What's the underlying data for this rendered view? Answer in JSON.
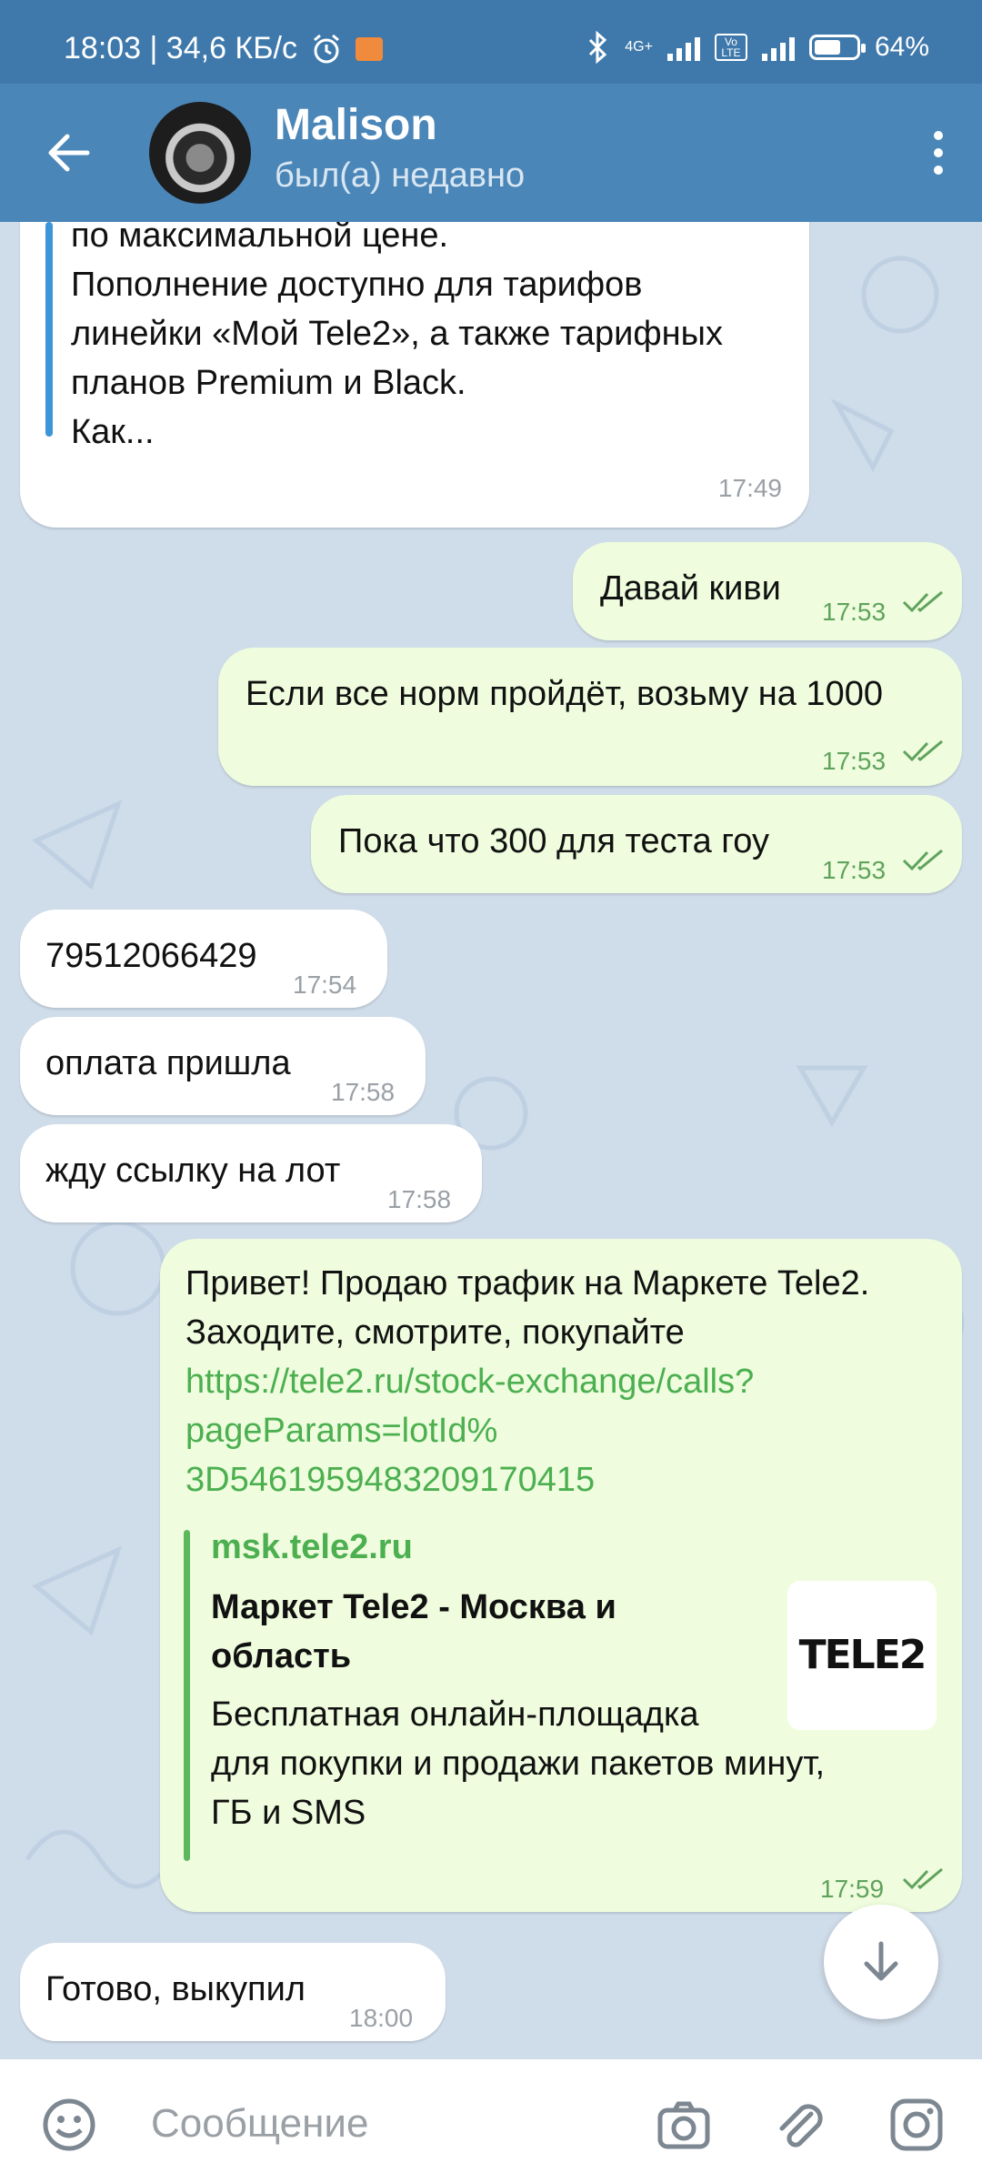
{
  "status_bar": {
    "time_speed": "18:03 | 34,6 КБ/с",
    "network_1": "4G+",
    "network_2": "Vo LTE",
    "battery": "64%",
    "battery_level": 0.64
  },
  "header": {
    "contact_name": "Malison",
    "contact_status": "был(а) недавно"
  },
  "messages": {
    "m1": {
      "lines": [
        "по максимальной цене.",
        "Пополнение доступно для тарифов",
        "линейки «Мой Tele2», а также тарифных",
        "планов Premium и Black.",
        "Как..."
      ],
      "time": "17:49"
    },
    "m2": {
      "text": "Давай киви",
      "time": "17:53"
    },
    "m3": {
      "text": "Если все норм пройдёт, возьму на 1000",
      "time": "17:53"
    },
    "m4": {
      "text": "Пока что 300 для теста гоу",
      "time": "17:53"
    },
    "m5": {
      "text": "79512066429",
      "time": "17:54"
    },
    "m6": {
      "text": "оплата пришла",
      "time": "17:58"
    },
    "m7": {
      "text": "жду ссылку на лот",
      "time": "17:58"
    },
    "m8": {
      "line1": "Привет! Продаю трафик на Маркете Tele2.",
      "line2": "Заходите, смотрите, покупайте",
      "link1": "https://tele2.ru/stock-exchange/calls?",
      "link2": "pageParams=lotId%",
      "link3": "3D5461959483209170415",
      "preview_site": "msk.tele2.ru",
      "preview_title1": "Маркет Tele2 - Москва и",
      "preview_title2": "область",
      "preview_desc1": "Бесплатная онлайн-площадка",
      "preview_desc2": "для покупки и продажи пакетов минут,",
      "preview_desc3": "ГБ и SMS",
      "preview_logo": "TELE2",
      "time": "17:59"
    },
    "m9": {
      "text": "Готово, выкупил",
      "time": "18:00"
    }
  },
  "input": {
    "placeholder": "Сообщение"
  },
  "colors": {
    "header": "#4a86b8",
    "outgoing": "#effdde",
    "incoming": "#ffffff",
    "link": "#4caf50",
    "chat_bg": "#cfdce9"
  },
  "icons": [
    "back-arrow-icon",
    "more-vert-icon",
    "emoji-icon",
    "camera-icon",
    "attach-icon",
    "instagram-icon",
    "double-check-icon",
    "arrow-down-icon"
  ]
}
